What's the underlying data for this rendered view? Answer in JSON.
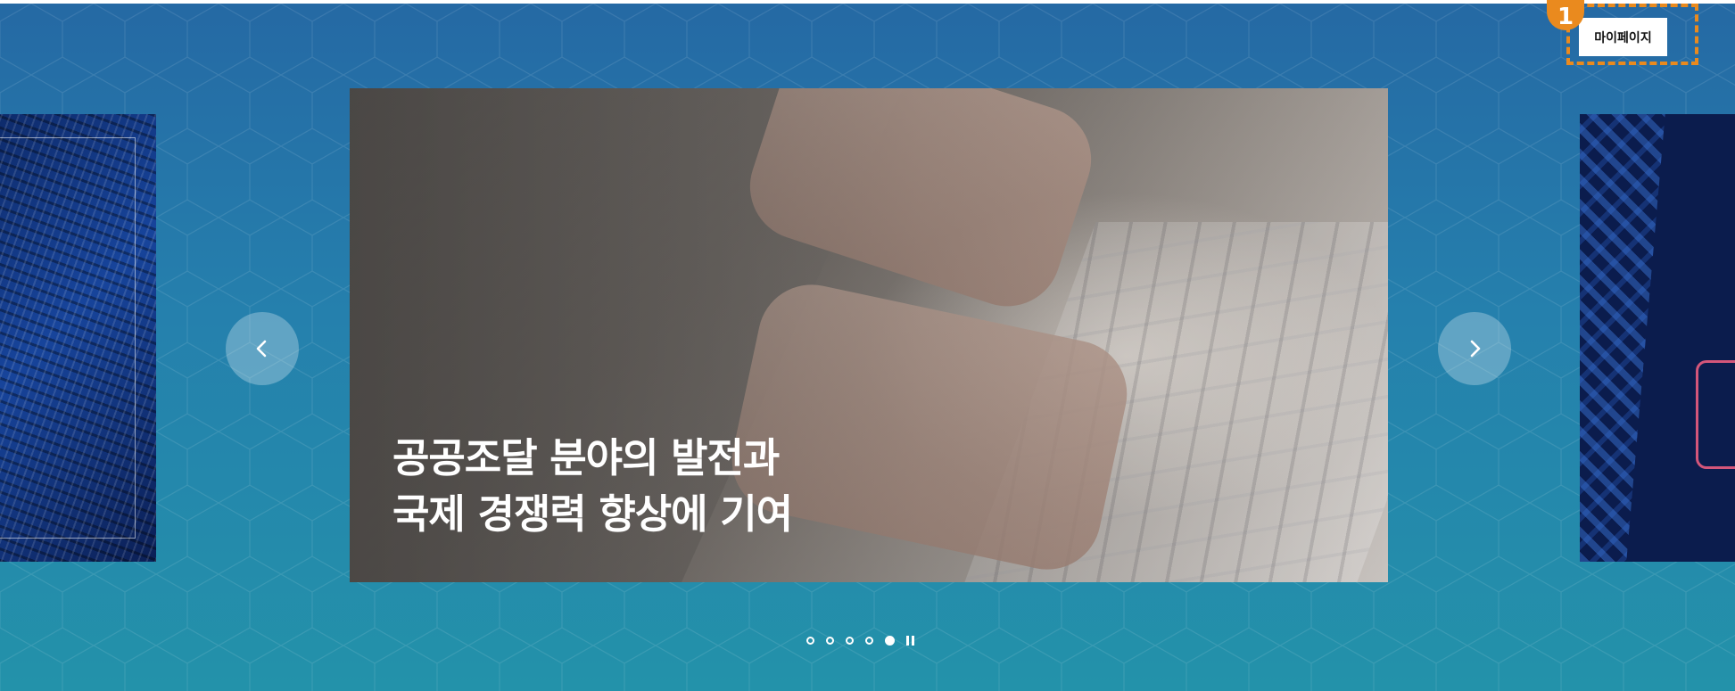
{
  "annotation": {
    "step_number": "1"
  },
  "header": {
    "mypage_label": "마이페이지"
  },
  "carousel": {
    "caption_line1": "공공조달 분야의 발전과",
    "caption_line2": "국제 경쟁력 향상에 기여",
    "prev_icon": "chevron-left-icon",
    "next_icon": "chevron-right-icon",
    "pager": {
      "count": 5,
      "active_index": 4,
      "pause_icon": "pause-icon"
    }
  },
  "colors": {
    "background_top": "#2569a4",
    "background_bottom": "#2392aa",
    "annotation_orange": "#ea8a1e"
  }
}
